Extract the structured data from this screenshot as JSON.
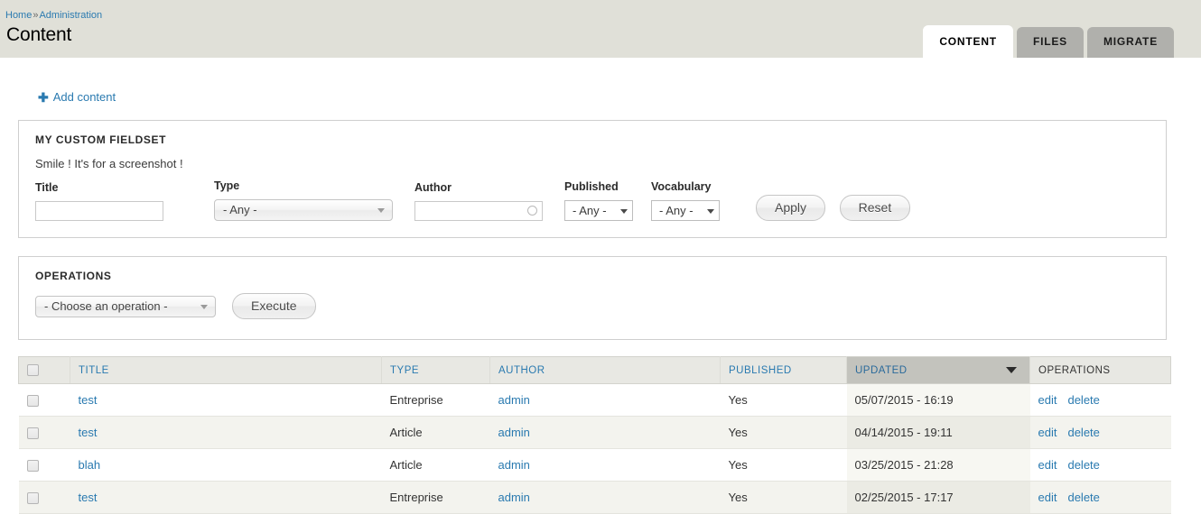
{
  "header": {
    "breadcrumb": [
      {
        "label": "Home",
        "link": true
      },
      {
        "label": "Administration",
        "link": true
      }
    ],
    "breadcrumb_separator": "»",
    "title": "Content",
    "tabs": [
      {
        "label": "CONTENT",
        "active": true
      },
      {
        "label": "FILES",
        "active": false
      },
      {
        "label": "MIGRATE",
        "active": false
      }
    ]
  },
  "action_links": {
    "add_content": "Add content",
    "plus_glyph": "✚"
  },
  "filter_fieldset": {
    "legend": "MY CUSTOM FIELDSET",
    "description": "Smile ! It's for a screenshot !",
    "fields": {
      "title": {
        "label": "Title",
        "value": "",
        "placeholder": ""
      },
      "type": {
        "label": "Type",
        "value": "- Any -"
      },
      "author": {
        "label": "Author",
        "value": "",
        "placeholder": ""
      },
      "published": {
        "label": "Published",
        "value": "- Any -"
      },
      "vocabulary": {
        "label": "Vocabulary",
        "value": "- Any -"
      }
    },
    "buttons": {
      "apply": "Apply",
      "reset": "Reset"
    }
  },
  "operations_fieldset": {
    "legend": "OPERATIONS",
    "select_value": "- Choose an operation -",
    "execute_label": "Execute"
  },
  "table": {
    "columns": [
      {
        "key": "select",
        "label": "",
        "sortable": false,
        "active_sort": false
      },
      {
        "key": "title",
        "label": "TITLE",
        "sortable": true,
        "active_sort": false
      },
      {
        "key": "type",
        "label": "TYPE",
        "sortable": true,
        "active_sort": false
      },
      {
        "key": "author",
        "label": "AUTHOR",
        "sortable": true,
        "active_sort": false
      },
      {
        "key": "published",
        "label": "PUBLISHED",
        "sortable": true,
        "active_sort": false
      },
      {
        "key": "updated",
        "label": "UPDATED",
        "sortable": true,
        "active_sort": true,
        "sort_direction": "desc"
      },
      {
        "key": "operations",
        "label": "OPERATIONS",
        "sortable": false,
        "active_sort": false
      }
    ],
    "rows": [
      {
        "title": "test",
        "type": "Entreprise",
        "author": "admin",
        "published": "Yes",
        "updated": "05/07/2015 - 16:19",
        "ops": {
          "edit": "edit",
          "delete": "delete"
        }
      },
      {
        "title": "test",
        "type": "Article",
        "author": "admin",
        "published": "Yes",
        "updated": "04/14/2015 - 19:11",
        "ops": {
          "edit": "edit",
          "delete": "delete"
        }
      },
      {
        "title": "blah",
        "type": "Article",
        "author": "admin",
        "published": "Yes",
        "updated": "03/25/2015 - 21:28",
        "ops": {
          "edit": "edit",
          "delete": "delete"
        }
      },
      {
        "title": "test",
        "type": "Entreprise",
        "author": "admin",
        "published": "Yes",
        "updated": "02/25/2015 - 17:17",
        "ops": {
          "edit": "edit",
          "delete": "delete"
        }
      }
    ]
  },
  "colors": {
    "link": "#2a7ab0",
    "header_band": "#e0e0d8",
    "tab_inactive": "#b0b0ac",
    "table_header": "#e8e8e3",
    "active_sort_header": "#c3c3bd",
    "row_even": "#f3f3ee"
  }
}
